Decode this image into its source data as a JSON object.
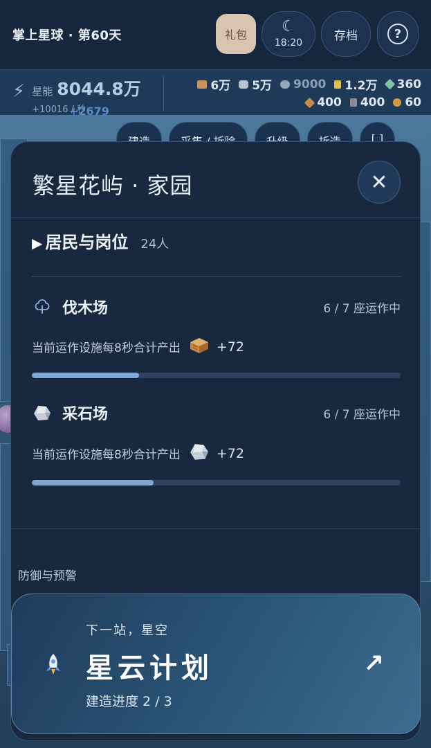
{
  "header": {
    "title": "掌上星球 · 第60天",
    "gift_label": "礼包",
    "moon_icon": "moon-icon",
    "time": "18:20",
    "save_label": "存档",
    "help_icon": "help-icon"
  },
  "resources": {
    "energy_label": "星能",
    "energy_value": "8044.8万",
    "energy_rate": "+10016 / 秒",
    "energy_popup": "+2679",
    "row1": [
      {
        "icon": "wood-crate-icon",
        "color": "#c9925a",
        "value": "6万"
      },
      {
        "icon": "stone-icon",
        "color": "#b8c4d0",
        "value": "5万"
      },
      {
        "icon": "iron-ore-icon",
        "color": "#97a6b4",
        "value": "9000"
      },
      {
        "icon": "grain-icon",
        "color": "#e0c050",
        "value": "1.2万"
      },
      {
        "icon": "crystal-icon",
        "color": "#7fc4a0",
        "value": "360"
      }
    ],
    "row2": [
      {
        "icon": "tools-icon",
        "color": "#c98a4a",
        "value": "400"
      },
      {
        "icon": "stone-block-icon",
        "color": "#8e8a96",
        "value": "400"
      },
      {
        "icon": "gear-icon",
        "color": "#d89a48",
        "value": "60"
      }
    ]
  },
  "tabs": [
    "建造",
    "采集 / 拆除",
    "升级",
    "拆造",
    "[ ]"
  ],
  "modal": {
    "title": "繁星花屿 · 家园",
    "close_icon": "close-icon",
    "section": {
      "title": "居民与岗位",
      "count": "24人"
    },
    "facilities": [
      {
        "name": "伐木场",
        "icon": "tree-icon",
        "status": "6 / 7 座运作中",
        "desc": "当前运作设施每8秒合计产出",
        "output_icon": "wood-crate-icon",
        "amount": "+72",
        "progress": 0.29
      },
      {
        "name": "采石场",
        "icon": "stone-icon",
        "status": "6 / 7 座运作中",
        "desc": "当前运作设施每8秒合计产出",
        "output_icon": "stone-icon",
        "amount": "+72",
        "progress": 0.33
      }
    ],
    "defense_label": "防御与预警"
  },
  "next_station": {
    "subtitle": "下一站，星空",
    "title": "星云计划",
    "progress_text": "建造进度 2 / 3",
    "icon": "rocket-icon",
    "arrow_icon": "arrow-up-right-icon"
  }
}
